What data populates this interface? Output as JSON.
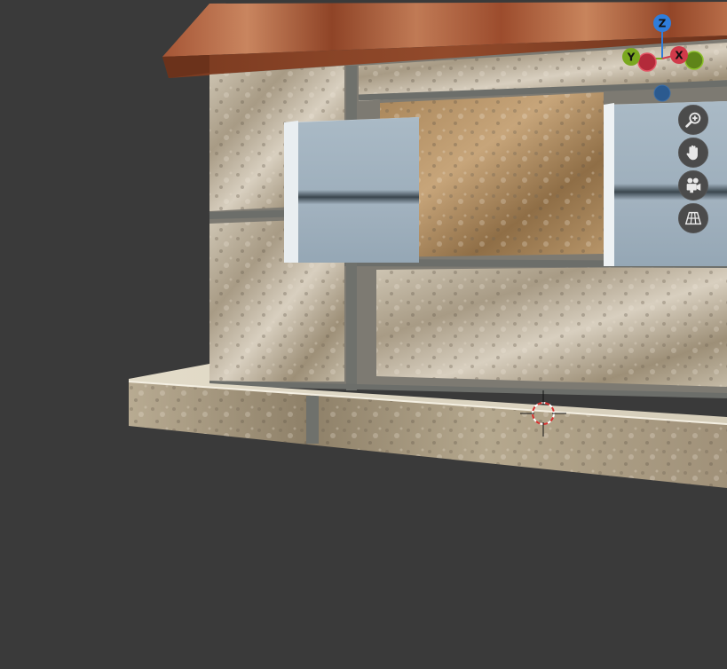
{
  "app": "3D Viewport",
  "gizmo": {
    "z_label": "Z",
    "y_label": "Y",
    "x_label": "X",
    "colors": {
      "z": "#2f7ddb",
      "y": "#7aa81f",
      "x": "#d03a4a",
      "neg_z": "#2b5a8f",
      "neg_x": "#b32a3a",
      "neg_y": "#7aa81f"
    }
  },
  "nav_controls": [
    {
      "name": "zoom",
      "icon": "magnifier-plus-icon"
    },
    {
      "name": "pan",
      "icon": "hand-icon"
    },
    {
      "name": "camera",
      "icon": "camera-icon"
    },
    {
      "name": "perspective",
      "icon": "grid-perspective-icon"
    }
  ],
  "scene": {
    "objects": [
      "roof",
      "stone-wall",
      "window-left",
      "window-right",
      "foundation-slab"
    ],
    "cursor": "3d-cursor"
  }
}
